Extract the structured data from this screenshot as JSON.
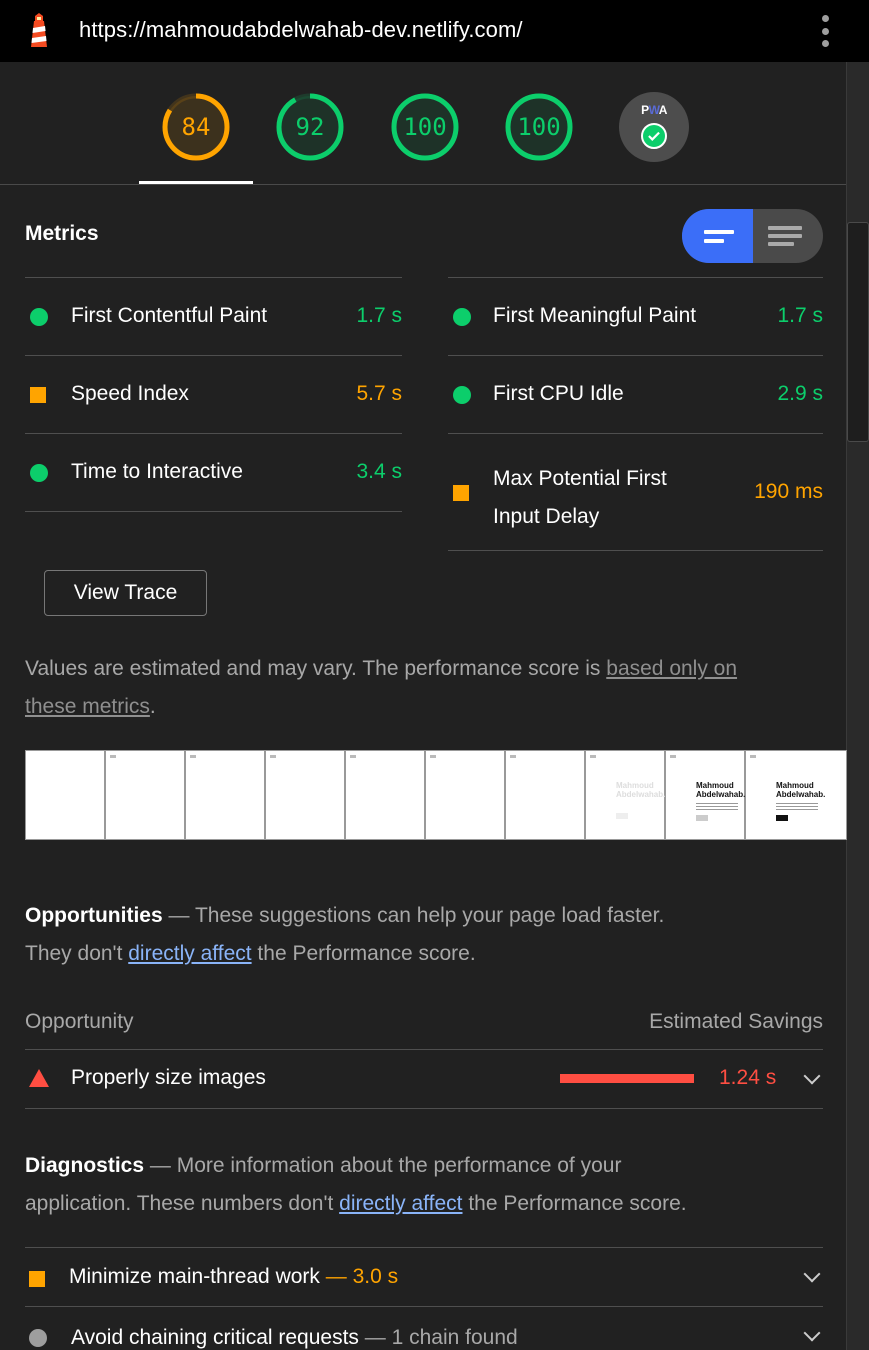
{
  "browser": {
    "url": "https://mahmoudabdelwahab-dev.netlify.com/",
    "logo_icon": "lighthouse-icon",
    "menu_icon": "kebab-menu-icon"
  },
  "gauges": [
    {
      "label": "84",
      "score": 84,
      "color": "#ffa400"
    },
    {
      "label": "92",
      "score": 92,
      "color": "#0cce6b"
    },
    {
      "label": "100",
      "score": 100,
      "color": "#0cce6b"
    },
    {
      "label": "100",
      "score": 100,
      "color": "#0cce6b"
    }
  ],
  "pwa": {
    "label_p": "P",
    "label_w": "W",
    "label_a": "A",
    "icon": "checkmark-icon"
  },
  "metrics": {
    "title": "Metrics",
    "items": [
      {
        "name": "First Contentful Paint",
        "value": "1.7 s",
        "status": "pass"
      },
      {
        "name": "First Meaningful Paint",
        "value": "1.7 s",
        "status": "pass"
      },
      {
        "name": "Speed Index",
        "value": "5.7 s",
        "status": "average"
      },
      {
        "name": "First CPU Idle",
        "value": "2.9 s",
        "status": "pass"
      },
      {
        "name": "Time to Interactive",
        "value": "3.4 s",
        "status": "pass"
      },
      {
        "name_line1": "Max Potential First",
        "name_line2": "Input Delay",
        "value": "190 ms",
        "status": "average"
      }
    ],
    "view_trace": "View Trace",
    "note_prefix": "Values are estimated and may vary. The performance score is ",
    "note_link_1": "based only on",
    "note_link_2": "these metrics",
    "note_suffix": "."
  },
  "filmstrip": {
    "frame_title_1": "Mahmoud",
    "frame_title_2": "Abdelwahab."
  },
  "opportunities": {
    "title": "Opportunities",
    "dash": " — ",
    "desc_1": "These suggestions can help your page load faster.",
    "desc_2_prefix": "They don't ",
    "desc_2_link": "directly affect",
    "desc_2_suffix": " the Performance score.",
    "col_left": "Opportunity",
    "col_right": "Estimated Savings",
    "items": [
      {
        "name": "Properly size images",
        "saving": "1.24 s"
      }
    ]
  },
  "diagnostics": {
    "title": "Diagnostics",
    "dash": " — ",
    "desc_1": "More information about the performance of your",
    "desc_2_prefix": "application. These numbers don't ",
    "desc_2_link": "directly affect",
    "desc_2_suffix": " the Performance score.",
    "items": [
      {
        "name": "Minimize main-thread work",
        "detail": "— 3.0 s"
      },
      {
        "name": "Avoid chaining critical requests",
        "detail": "— 1 chain found"
      }
    ]
  }
}
